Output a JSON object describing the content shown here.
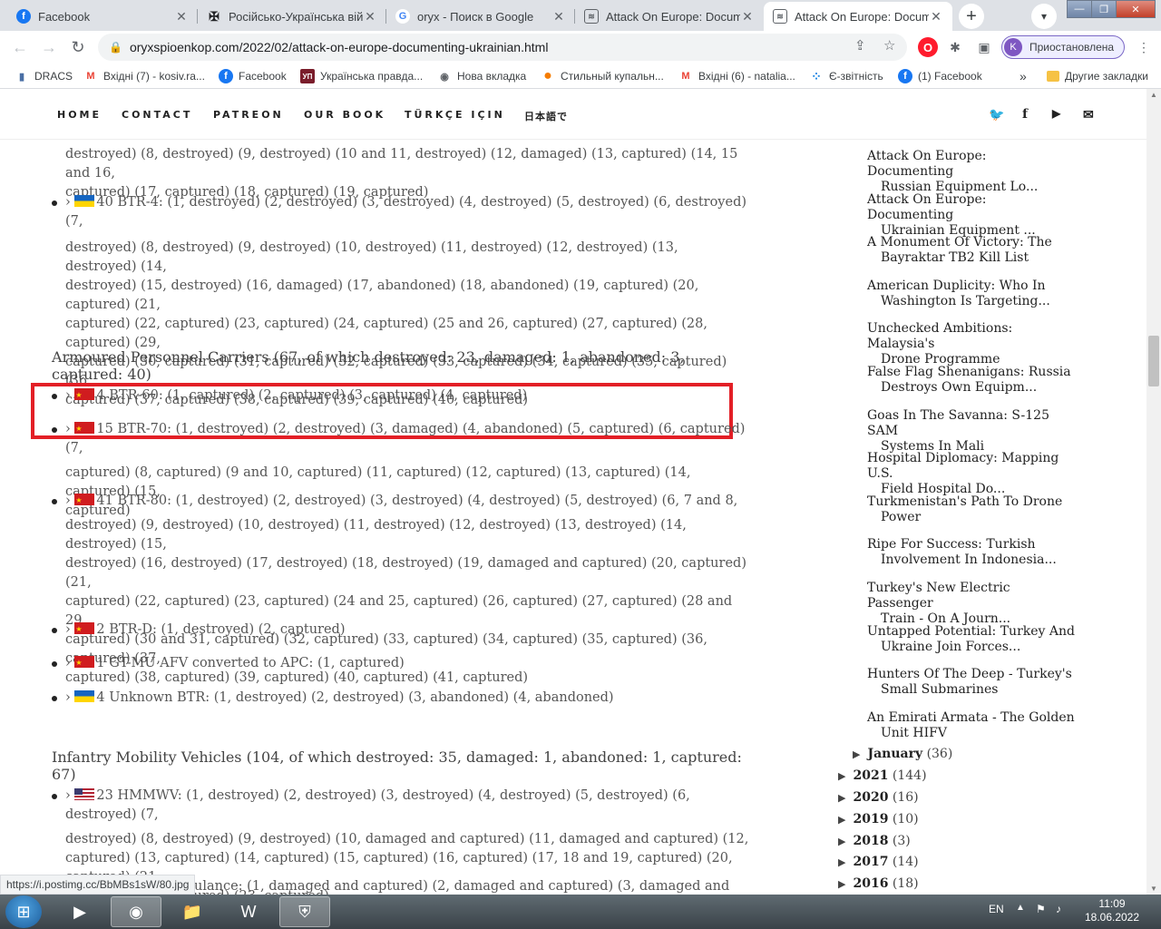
{
  "tabs": [
    {
      "title": "Facebook",
      "icon": "facebook-icon",
      "fav": "f"
    },
    {
      "title": "Російсько-Українська війна",
      "icon": "wikipedia-icon",
      "fav": "✠"
    },
    {
      "title": "oryx - Поиск в Google",
      "icon": "google-icon",
      "fav": "G"
    },
    {
      "title": "Attack On Europe: Documenting",
      "icon": "oryx-site-icon",
      "fav": "≋"
    },
    {
      "title": "Attack On Europe: Documenting",
      "icon": "oryx-site-icon",
      "fav": "≋"
    }
  ],
  "address": {
    "url": "oryxspioenkop.com/2022/02/attack-on-europe-documenting-ukrainian.html"
  },
  "profile": {
    "initial": "K",
    "label": "Приостановлена"
  },
  "bookmarks": [
    {
      "label": "DRACS",
      "fav": "▮"
    },
    {
      "label": "Вхідні (7) - kosiv.ra...",
      "fav": "M"
    },
    {
      "label": "Facebook",
      "fav": "f"
    },
    {
      "label": "Українська правда...",
      "fav": "УП"
    },
    {
      "label": "Нова вкладка",
      "fav": "◉"
    },
    {
      "label": "Стильный купальн...",
      "fav": "●"
    },
    {
      "label": "Вхідні (6) - natalia...",
      "fav": "M"
    },
    {
      "label": "Є-звітність",
      "fav": "⁘"
    },
    {
      "label": "(1) Facebook",
      "fav": "f"
    }
  ],
  "bookmarks_more": "»",
  "other_bookmarks": "Другие закладки",
  "site_nav": [
    "HOME",
    "CONTACT",
    "PATREON",
    "OUR BOOK",
    "TÜRKÇE IÇIN",
    "日本語で"
  ],
  "content": {
    "p0": "destroyed) (8, destroyed) (9, destroyed) (10 and 11, destroyed) (12, damaged) (13, captured) (14, 15 and 16,",
    "p0b": "captured) (17, captured) (18, captured) (19, captured)",
    "btr4_first": "40 BTR-4: (1, destroyed) (2, destroyed) (3, destroyed) (4, destroyed) (5, destroyed) (6, destroyed) (7,",
    "btr4_rest": [
      "destroyed) (8, destroyed) (9, destroyed) (10, destroyed) (11, destroyed) (12, destroyed) (13, destroyed) (14,",
      "destroyed) (15, destroyed) (16, damaged) (17, abandoned) (18, abandoned) (19, captured) (20, captured) (21,",
      "captured) (22, captured) (23, captured) (24, captured) (25 and 26, captured) (27, captured) (28, captured) (29,",
      "captured) (30, captured) (31, captured) (32, captured) (33, captured) (34, captured) (35, captured) (36,",
      "captured) (37, captured) (38, captured) (39, captured) (40, captured)"
    ],
    "apc_heading": "Armoured Personnel Carriers (67, of which destroyed: 23, damaged: 1, abandoned: 3, captured: 40)",
    "btr60": "4 BTR-60: (1, captured) (2, captured) (3, captured) (4, captured)",
    "btr70_first": "15 BTR-70: (1, destroyed) (2, destroyed) (3, damaged) (4, abandoned) (5, captured) (6, captured) (7,",
    "btr70_rest": [
      "captured) (8, captured) (9 and 10, captured) (11, captured) (12, captured) (13, captured) (14, captured) (15,",
      "captured)"
    ],
    "btr80_first": "41 BTR-80: (1, destroyed) (2, destroyed) (3, destroyed) (4, destroyed) (5, destroyed) (6, 7 and 8,",
    "btr80_rest": [
      "destroyed) (9, destroyed) (10, destroyed) (11, destroyed) (12, destroyed) (13, destroyed) (14, destroyed) (15,",
      "destroyed) (16, destroyed) (17, destroyed) (18, destroyed) (19, damaged and captured) (20, captured) (21,",
      "captured) (22, captured) (23, captured) (24 and 25, captured) (26, captured) (27, captured) (28 and 29,",
      "captured) (30 and 31, captured) (32, captured) (33, captured) (34, captured) (35, captured) (36, captured) (37,",
      "captured) (38, captured) (39, captured) (40, captured) (41, captured)"
    ],
    "btrd": "2 BTR-D: (1, destroyed) (2, captured)",
    "gtmu": "1 GT-MU AFV converted to APC: (1, captured)",
    "unknown_btr": "4 Unknown BTR: (1, destroyed) (2, destroyed) (3, abandoned) (4, abandoned)",
    "imv_heading": "Infantry Mobility Vehicles (104, of which destroyed: 35, damaged: 1, abandoned: 1, captured: 67)",
    "hmmwv_first": "23 HMMWV: (1, destroyed) (2, destroyed) (3, destroyed) (4, destroyed) (5, destroyed) (6, destroyed) (7,",
    "hmmwv_rest": [
      "destroyed) (8, destroyed) (9, destroyed) (10, damaged and captured) (11, damaged and captured) (12,",
      "captured) (13, captured) (14, captured) (15, captured) (16, captured) (17, 18 and 19, captured) (20, captured) (21,",
      "captured) (22, captured) (23, captured)"
    ],
    "last_partial": "ulance: (1, damaged and captured) (2, damaged and captured) (3, damaged and"
  },
  "sidebar_posts": [
    [
      "Attack On Europe: Documenting",
      "Russian Equipment Lo..."
    ],
    [
      "Attack On Europe: Documenting",
      "Ukrainian Equipment ..."
    ],
    [
      "A Monument Of Victory: The",
      "Bayraktar TB2 Kill List"
    ],
    [
      "American Duplicity: Who In",
      "Washington Is Targeting..."
    ],
    [
      "Unchecked Ambitions: Malaysia's",
      "Drone Programme"
    ],
    [
      "False Flag Shenanigans: Russia",
      "Destroys Own Equipm..."
    ],
    [
      "Goas In The Savanna: S-125 SAM",
      "Systems In Mali"
    ],
    [
      "Hospital Diplomacy: Mapping U.S.",
      "Field Hospital Do..."
    ],
    [
      "Turkmenistan's Path To Drone",
      "Power"
    ],
    [
      "Ripe For Success: Turkish",
      "Involvement In Indonesia..."
    ],
    [
      "Turkey's New Electric Passenger",
      "Train - On A Journ..."
    ],
    [
      "Untapped Potential: Turkey And",
      "Ukraine Join Forces..."
    ],
    [
      "Hunters Of The Deep - Turkey's",
      "Small Submarines"
    ],
    [
      "An Emirati Armata - The Golden",
      "Unit HIFV"
    ]
  ],
  "archive": [
    {
      "label": "January",
      "count": "(36)"
    },
    {
      "label": "2021",
      "count": "(144)"
    },
    {
      "label": "2020",
      "count": "(16)"
    },
    {
      "label": "2019",
      "count": "(10)"
    },
    {
      "label": "2018",
      "count": "(3)"
    },
    {
      "label": "2017",
      "count": "(14)"
    },
    {
      "label": "2016",
      "count": "(18)"
    }
  ],
  "status_url": "https://i.postimg.cc/BbMBs1sW/80.jpg",
  "taskbar": {
    "lang": "EN",
    "time": "11:09",
    "date": "18.06.2022"
  },
  "colors": {
    "highlight_box": "#e31f26",
    "tab_strip": "#dee1e6"
  }
}
